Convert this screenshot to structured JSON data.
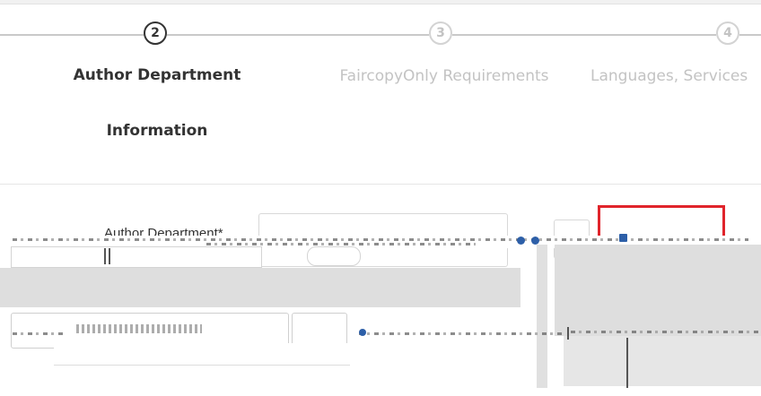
{
  "stepper": {
    "steps": [
      {
        "number": "2",
        "label_line1": "Author Department",
        "label_line2": "Information",
        "state": "active"
      },
      {
        "number": "3",
        "label": "FaircopyOnly Requirements",
        "state": "inactive"
      },
      {
        "number": "4",
        "label": "Languages, Services",
        "state": "inactive"
      }
    ]
  },
  "form": {
    "author_department_label": "Author Department*"
  },
  "colors": {
    "active_step": "#333333",
    "inactive_step": "#c3c3c3",
    "highlight_box": "#e0242b",
    "accent_blue": "#2d5fa8"
  }
}
